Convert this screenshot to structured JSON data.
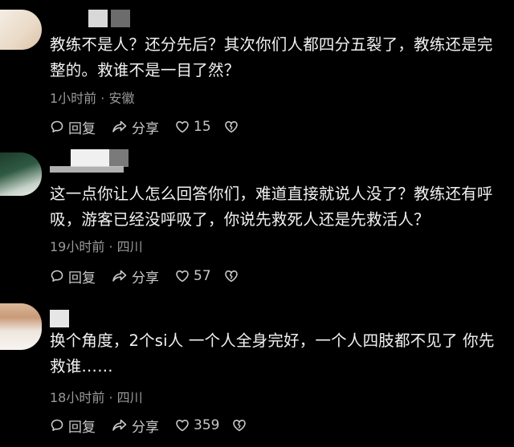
{
  "comments": [
    {
      "text": "教练不是人？还分先后？其次你们人都四分五裂了，教练还是完整的。救谁不是一目了然？",
      "time": "1小时前",
      "location": "安徽",
      "reply_label": "回复",
      "share_label": "分享",
      "likes": "15"
    },
    {
      "text": "这一点你让人怎么回答你们，难道直接就说人没了？教练还有呼吸，游客已经没呼吸了，你说先救死人还是先救活人？",
      "time": "19小时前",
      "location": "四川",
      "reply_label": "回复",
      "share_label": "分享",
      "likes": "57"
    },
    {
      "text": "换个角度，2个si人 一个人全身完好，一个人四肢都不见了 你先救谁……",
      "time": "18小时前",
      "location": "四川",
      "reply_label": "回复",
      "share_label": "分享",
      "likes": "359"
    }
  ],
  "meta_separator": "·",
  "colors": {
    "background": "#000000",
    "text": "#f2f2f2",
    "meta": "#9a9a9a",
    "icons": "#c9c9c9"
  }
}
